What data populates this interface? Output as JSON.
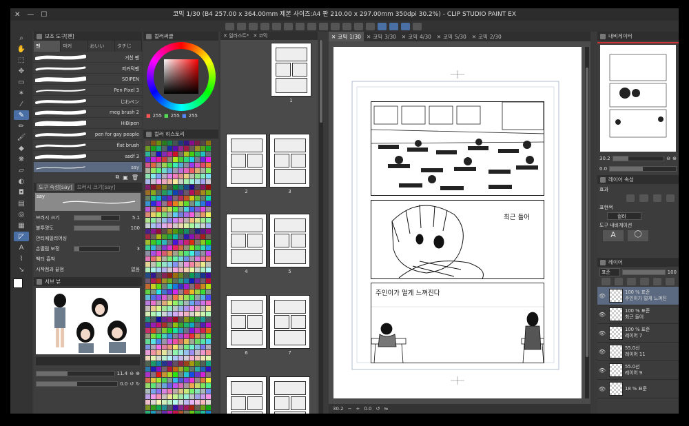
{
  "window": {
    "title": "코믹 1/30 (B4 257.00 x 364.00mm 제본 사이즈:A4 판 210.00 x 297.00mm 350dpi 30.2%) - CLIP STUDIO PAINT EX"
  },
  "subtool": {
    "panel_title": "보조 도구[펜]",
    "tabs": [
      "펜",
      "마커",
      "おいい",
      "タチじ"
    ],
    "brushes": [
      "거친 펜",
      "퍼커덕펜",
      "SOIPEN",
      "Pen Pixel 3",
      "じわペン",
      "meg brush 2",
      "HiBipen",
      "pen for gay people",
      "flat brush",
      "asdf 3",
      "say"
    ],
    "selected_brush": "say"
  },
  "tool_property": {
    "tab1": "도구 속성[say]",
    "tab2": "브러시 크기[say]",
    "preview_label": "say",
    "rows": [
      {
        "label": "브러시 크기",
        "value": "5.1",
        "fill": 0.6
      },
      {
        "label": "불투명도",
        "value": "100",
        "fill": 1.0
      },
      {
        "label": "안티에일리어싱",
        "value": ""
      },
      {
        "label": "손떨림 보정",
        "value": "3",
        "fill": 0.1
      },
      {
        "label": "벡터 흡착",
        "value": ""
      },
      {
        "label": "시작점과 끝점",
        "value": "없음"
      }
    ]
  },
  "subview": {
    "title": "서브 뷰",
    "zoom": "11.4",
    "rotation": "0.0"
  },
  "color_wheel": {
    "title": "컬러써클",
    "r": "255",
    "g": "255",
    "b": "255"
  },
  "color_history": {
    "title": "컬러 히스토리"
  },
  "page_manager": {
    "tabs": [
      "일러스트*",
      "코믹"
    ],
    "pages": [
      "1",
      "2",
      "3",
      "4",
      "5",
      "6",
      "7"
    ]
  },
  "doc_tabs": [
    {
      "label": "코믹",
      "page": "1/30",
      "sel": true
    },
    {
      "label": "코믹",
      "page": "3/30",
      "sel": false
    },
    {
      "label": "코믹",
      "page": "4/30",
      "sel": false
    },
    {
      "label": "코믹",
      "page": "5/30",
      "sel": false
    },
    {
      "label": "코믹",
      "page": "2/30",
      "sel": false
    }
  ],
  "canvas": {
    "text1": "최근 들어",
    "text2": "주인이가 멀게 느껴진다",
    "zoom": "30.2",
    "angle": "0.0"
  },
  "navigator": {
    "title": "내비게이터",
    "zoom": "30.2",
    "angle": "0.0"
  },
  "layer_property": {
    "title": "레이어 속성",
    "effect_label": "효과",
    "expression_label": "표현색",
    "expression_value": "컬러",
    "tool_nav_label": "도구 내비게이션"
  },
  "layer_panel": {
    "title": "레이어",
    "blend": "표준",
    "opacity": "100",
    "layers": [
      {
        "mode": "100 % 표준",
        "name": "주인이가 멀게 느껴진",
        "sel": true
      },
      {
        "mode": "100 % 표준",
        "name": "최근 들어",
        "sel": false
      },
      {
        "mode": "100 % 표준",
        "name": "레이어 7",
        "sel": false
      },
      {
        "mode": "55.0선",
        "name": "레이어 11",
        "sel": false
      },
      {
        "mode": "55.0선",
        "name": "레이어 9",
        "sel": false
      },
      {
        "mode": "18 % 표준",
        "name": "",
        "sel": false
      }
    ]
  }
}
